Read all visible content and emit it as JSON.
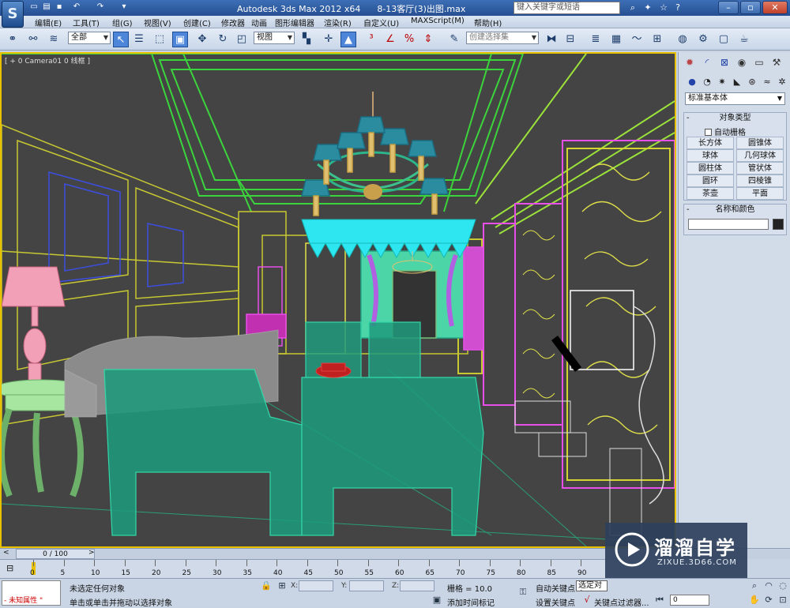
{
  "titlebar": {
    "app_title": "Autodesk 3ds Max  2012 x64",
    "file_name": "8-13客厅(3)出图.max",
    "search_placeholder": "键入关键字或短语"
  },
  "menu": [
    "编辑(E)",
    "工具(T)",
    "组(G)",
    "视图(V)",
    "创建(C)",
    "修改器",
    "动画",
    "图形编辑器",
    "渲染(R)",
    "自定义(U)",
    "MAXScript(M)",
    "帮助(H)"
  ],
  "toolbar": {
    "selection_filter": "全部",
    "reference_coord": "视图",
    "named_selection": "创建选择集"
  },
  "viewport": {
    "label": "[ + 0 Camera01 0 线框 ]"
  },
  "command_panel": {
    "primitive_type": "标准基本体",
    "object_type_title": "对象类型",
    "autogrid_label": "自动栅格",
    "objects": [
      "长方体",
      "圆锥体",
      "球体",
      "几何球体",
      "圆柱体",
      "管状体",
      "圆环",
      "四棱锥",
      "茶壶",
      "平面"
    ],
    "name_color_title": "名称和颜色"
  },
  "timeline": {
    "frame_counter": "0 / 100",
    "ticks": [
      "0",
      "5",
      "10",
      "15",
      "20",
      "25",
      "30",
      "35",
      "40",
      "45",
      "50",
      "55",
      "60",
      "65",
      "70",
      "75",
      "80",
      "85",
      "90"
    ]
  },
  "status": {
    "maxscript_text": "- 未知属性 \"",
    "line1": "未选定任何对象",
    "line2": "单击或单击并拖动以选择对象",
    "x_label": "X:",
    "y_label": "Y:",
    "z_label": "Z:",
    "grid": "栅格 = 10.0",
    "add_time_tag": "添加时间标记",
    "auto_key": "自动关键点",
    "set_key": "设置关键点",
    "selected": "选定对象",
    "key_filters": "关键点过滤器...",
    "frame_value": "0"
  },
  "watermark": {
    "name": "溜溜自学",
    "url": "ZIXUE.3D66.COM"
  }
}
